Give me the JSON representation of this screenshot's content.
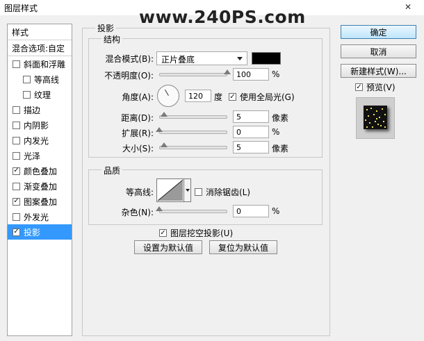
{
  "window": {
    "title": "图层样式",
    "watermark": "www.240PS.com",
    "close_glyph": "✕"
  },
  "styles_panel": {
    "header": "样式",
    "blend_options": "混合选项:自定",
    "items": [
      {
        "label": "斜面和浮雕",
        "checked": false,
        "indent": false
      },
      {
        "label": "等高线",
        "checked": false,
        "indent": true
      },
      {
        "label": "纹理",
        "checked": false,
        "indent": true
      },
      {
        "label": "描边",
        "checked": false,
        "indent": false
      },
      {
        "label": "内阴影",
        "checked": false,
        "indent": false
      },
      {
        "label": "内发光",
        "checked": false,
        "indent": false
      },
      {
        "label": "光泽",
        "checked": false,
        "indent": false
      },
      {
        "label": "颜色叠加",
        "checked": true,
        "indent": false
      },
      {
        "label": "渐变叠加",
        "checked": false,
        "indent": false
      },
      {
        "label": "图案叠加",
        "checked": true,
        "indent": false
      },
      {
        "label": "外发光",
        "checked": false,
        "indent": false
      },
      {
        "label": "投影",
        "checked": true,
        "indent": false,
        "selected": true
      }
    ]
  },
  "drop_shadow": {
    "section_title": "投影",
    "structure": {
      "title": "结构",
      "blend_mode_label": "混合模式(B):",
      "blend_mode_value": "正片叠底",
      "shadow_color": "#000000",
      "opacity_label": "不透明度(O):",
      "opacity_value": "100",
      "opacity_unit": "%",
      "opacity_fraction": 1.0,
      "angle_label": "角度(A):",
      "angle_value": "120",
      "angle_unit": "度",
      "global_light_label": "使用全局光(G)",
      "global_light_checked": true,
      "distance_label": "距离(D):",
      "distance_value": "5",
      "distance_unit": "像素",
      "distance_fraction": 0.02,
      "spread_label": "扩展(R):",
      "spread_value": "0",
      "spread_unit": "%",
      "spread_fraction": 0,
      "size_label": "大小(S):",
      "size_value": "5",
      "size_unit": "像素",
      "size_fraction": 0.02
    },
    "quality": {
      "title": "品质",
      "contour_label": "等高线:",
      "anti_alias_label": "消除锯齿(L)",
      "anti_alias_checked": false,
      "noise_label": "杂色(N):",
      "noise_value": "0",
      "noise_unit": "%",
      "noise_fraction": 0
    },
    "knockout_label": "图层挖空投影(U)",
    "knockout_checked": true,
    "set_default_label": "设置为默认值",
    "reset_default_label": "复位为默认值"
  },
  "actions": {
    "ok_label": "确定",
    "cancel_label": "取消",
    "new_style_label": "新建样式(W)...",
    "preview_label": "预览(V)",
    "preview_checked": true
  }
}
